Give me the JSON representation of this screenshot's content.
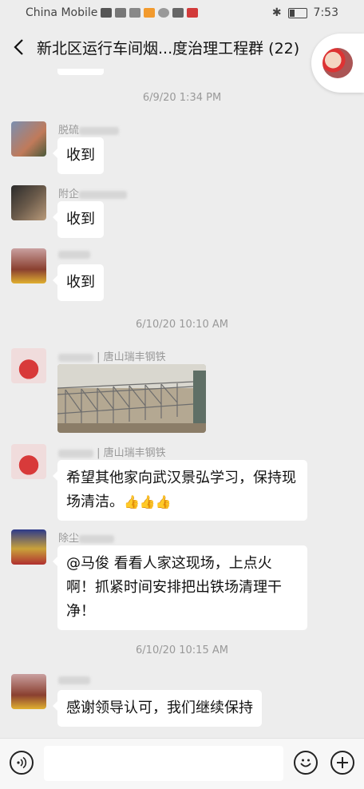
{
  "status_bar": {
    "carrier": "China Mobile",
    "time": "7:53"
  },
  "header": {
    "title": "新北区运行车间烟...度治理工程群 (22)"
  },
  "timestamps": [
    "6/9/20 1:34 PM",
    "6/10/20 10:10 AM",
    "6/10/20 10:15 AM"
  ],
  "messages": [
    {
      "name": "脱硫",
      "text": "收到"
    },
    {
      "name": "附企",
      "text": "收到"
    },
    {
      "name": "",
      "text": "收到"
    },
    {
      "name": "唐山瑞丰钢铁",
      "image": "construction-site-photo"
    },
    {
      "name": "唐山瑞丰钢铁",
      "text": "希望其他家向武汉景弘学习，保持现场清洁。",
      "emoji": "👍👍👍"
    },
    {
      "name": "除尘",
      "text": "@马俊  看看人家这现场，上点火啊！抓紧时间安排把出铁场清理干净！"
    },
    {
      "name": "",
      "text": "感谢领导认可，我们继续保持"
    }
  ],
  "name_separator": " | ",
  "input": {
    "placeholder": ""
  },
  "colors": {
    "background": "#ededed",
    "bubble": "#ffffff",
    "timestamp": "#999999"
  }
}
